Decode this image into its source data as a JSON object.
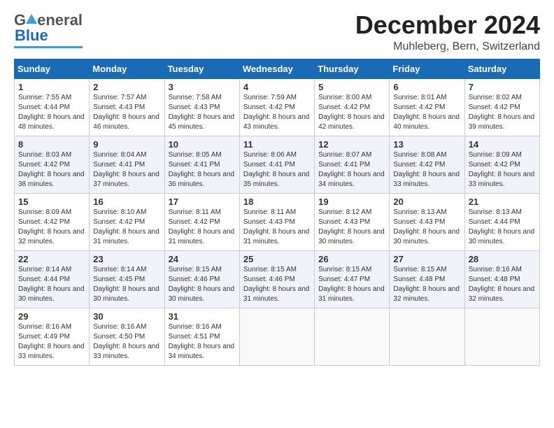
{
  "header": {
    "logo_general": "General",
    "logo_blue": "Blue",
    "month_title": "December 2024",
    "location": "Muhleberg, Bern, Switzerland"
  },
  "days_header": [
    "Sunday",
    "Monday",
    "Tuesday",
    "Wednesday",
    "Thursday",
    "Friday",
    "Saturday"
  ],
  "weeks": [
    [
      {
        "day": "1",
        "sunrise": "Sunrise: 7:55 AM",
        "sunset": "Sunset: 4:44 PM",
        "daylight": "Daylight: 8 hours and 48 minutes."
      },
      {
        "day": "2",
        "sunrise": "Sunrise: 7:57 AM",
        "sunset": "Sunset: 4:43 PM",
        "daylight": "Daylight: 8 hours and 46 minutes."
      },
      {
        "day": "3",
        "sunrise": "Sunrise: 7:58 AM",
        "sunset": "Sunset: 4:43 PM",
        "daylight": "Daylight: 8 hours and 45 minutes."
      },
      {
        "day": "4",
        "sunrise": "Sunrise: 7:59 AM",
        "sunset": "Sunset: 4:42 PM",
        "daylight": "Daylight: 8 hours and 43 minutes."
      },
      {
        "day": "5",
        "sunrise": "Sunrise: 8:00 AM",
        "sunset": "Sunset: 4:42 PM",
        "daylight": "Daylight: 8 hours and 42 minutes."
      },
      {
        "day": "6",
        "sunrise": "Sunrise: 8:01 AM",
        "sunset": "Sunset: 4:42 PM",
        "daylight": "Daylight: 8 hours and 40 minutes."
      },
      {
        "day": "7",
        "sunrise": "Sunrise: 8:02 AM",
        "sunset": "Sunset: 4:42 PM",
        "daylight": "Daylight: 8 hours and 39 minutes."
      }
    ],
    [
      {
        "day": "8",
        "sunrise": "Sunrise: 8:03 AM",
        "sunset": "Sunset: 4:42 PM",
        "daylight": "Daylight: 8 hours and 38 minutes."
      },
      {
        "day": "9",
        "sunrise": "Sunrise: 8:04 AM",
        "sunset": "Sunset: 4:41 PM",
        "daylight": "Daylight: 8 hours and 37 minutes."
      },
      {
        "day": "10",
        "sunrise": "Sunrise: 8:05 AM",
        "sunset": "Sunset: 4:41 PM",
        "daylight": "Daylight: 8 hours and 36 minutes."
      },
      {
        "day": "11",
        "sunrise": "Sunrise: 8:06 AM",
        "sunset": "Sunset: 4:41 PM",
        "daylight": "Daylight: 8 hours and 35 minutes."
      },
      {
        "day": "12",
        "sunrise": "Sunrise: 8:07 AM",
        "sunset": "Sunset: 4:41 PM",
        "daylight": "Daylight: 8 hours and 34 minutes."
      },
      {
        "day": "13",
        "sunrise": "Sunrise: 8:08 AM",
        "sunset": "Sunset: 4:42 PM",
        "daylight": "Daylight: 8 hours and 33 minutes."
      },
      {
        "day": "14",
        "sunrise": "Sunrise: 8:09 AM",
        "sunset": "Sunset: 4:42 PM",
        "daylight": "Daylight: 8 hours and 33 minutes."
      }
    ],
    [
      {
        "day": "15",
        "sunrise": "Sunrise: 8:09 AM",
        "sunset": "Sunset: 4:42 PM",
        "daylight": "Daylight: 8 hours and 32 minutes."
      },
      {
        "day": "16",
        "sunrise": "Sunrise: 8:10 AM",
        "sunset": "Sunset: 4:42 PM",
        "daylight": "Daylight: 8 hours and 31 minutes."
      },
      {
        "day": "17",
        "sunrise": "Sunrise: 8:11 AM",
        "sunset": "Sunset: 4:42 PM",
        "daylight": "Daylight: 8 hours and 31 minutes."
      },
      {
        "day": "18",
        "sunrise": "Sunrise: 8:11 AM",
        "sunset": "Sunset: 4:43 PM",
        "daylight": "Daylight: 8 hours and 31 minutes."
      },
      {
        "day": "19",
        "sunrise": "Sunrise: 8:12 AM",
        "sunset": "Sunset: 4:43 PM",
        "daylight": "Daylight: 8 hours and 30 minutes."
      },
      {
        "day": "20",
        "sunrise": "Sunrise: 8:13 AM",
        "sunset": "Sunset: 4:43 PM",
        "daylight": "Daylight: 8 hours and 30 minutes."
      },
      {
        "day": "21",
        "sunrise": "Sunrise: 8:13 AM",
        "sunset": "Sunset: 4:44 PM",
        "daylight": "Daylight: 8 hours and 30 minutes."
      }
    ],
    [
      {
        "day": "22",
        "sunrise": "Sunrise: 8:14 AM",
        "sunset": "Sunset: 4:44 PM",
        "daylight": "Daylight: 8 hours and 30 minutes."
      },
      {
        "day": "23",
        "sunrise": "Sunrise: 8:14 AM",
        "sunset": "Sunset: 4:45 PM",
        "daylight": "Daylight: 8 hours and 30 minutes."
      },
      {
        "day": "24",
        "sunrise": "Sunrise: 8:15 AM",
        "sunset": "Sunset: 4:46 PM",
        "daylight": "Daylight: 8 hours and 30 minutes."
      },
      {
        "day": "25",
        "sunrise": "Sunrise: 8:15 AM",
        "sunset": "Sunset: 4:46 PM",
        "daylight": "Daylight: 8 hours and 31 minutes."
      },
      {
        "day": "26",
        "sunrise": "Sunrise: 8:15 AM",
        "sunset": "Sunset: 4:47 PM",
        "daylight": "Daylight: 8 hours and 31 minutes."
      },
      {
        "day": "27",
        "sunrise": "Sunrise: 8:15 AM",
        "sunset": "Sunset: 4:48 PM",
        "daylight": "Daylight: 8 hours and 32 minutes."
      },
      {
        "day": "28",
        "sunrise": "Sunrise: 8:16 AM",
        "sunset": "Sunset: 4:48 PM",
        "daylight": "Daylight: 8 hours and 32 minutes."
      }
    ],
    [
      {
        "day": "29",
        "sunrise": "Sunrise: 8:16 AM",
        "sunset": "Sunset: 4:49 PM",
        "daylight": "Daylight: 8 hours and 33 minutes."
      },
      {
        "day": "30",
        "sunrise": "Sunrise: 8:16 AM",
        "sunset": "Sunset: 4:50 PM",
        "daylight": "Daylight: 8 hours and 33 minutes."
      },
      {
        "day": "31",
        "sunrise": "Sunrise: 8:16 AM",
        "sunset": "Sunset: 4:51 PM",
        "daylight": "Daylight: 8 hours and 34 minutes."
      },
      null,
      null,
      null,
      null
    ]
  ]
}
